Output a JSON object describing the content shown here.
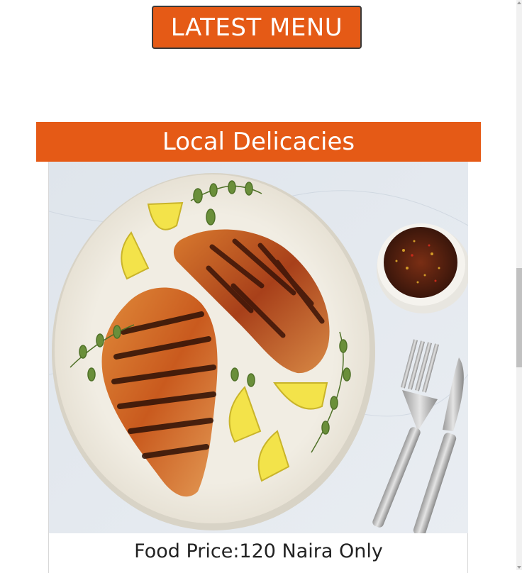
{
  "menu_button": {
    "label": "LATEST MENU"
  },
  "section": {
    "title": "Local Delicacies"
  },
  "food_card": {
    "image_alt": "grilled-chicken-plate",
    "price_text": "Food Price:120 Naira Only"
  },
  "colors": {
    "accent": "#e55a16",
    "background": "#ffffff",
    "text": "#222222"
  }
}
